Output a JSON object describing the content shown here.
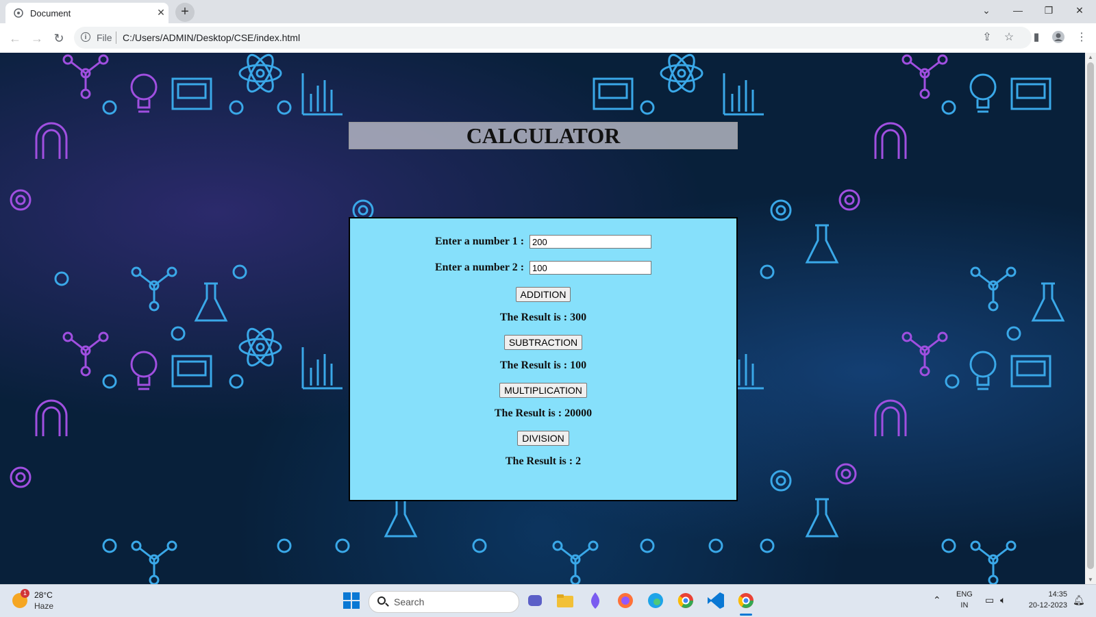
{
  "browser": {
    "tab_title": "Document",
    "tab_close": "✕",
    "new_tab": "+",
    "file_label": "File",
    "url": "C:/Users/ADMIN/Desktop/CSE/index.html"
  },
  "page": {
    "header": "CALCULATOR",
    "fields": [
      {
        "label": "Enter a number 1 :",
        "value": "200"
      },
      {
        "label": "Enter a number 2 :",
        "value": "100"
      }
    ],
    "operations": [
      {
        "button": "ADDITION",
        "result": "The Result is : 300"
      },
      {
        "button": "SUBTRACTION",
        "result": "The Result is : 100"
      },
      {
        "button": "MULTIPLICATION",
        "result": "The Result is : 20000"
      },
      {
        "button": "DIVISION",
        "result": "The Result is : 2"
      }
    ]
  },
  "taskbar": {
    "weather_temp": "28°C",
    "weather_cond": "Haze",
    "weather_badge": "1",
    "search_placeholder": "Search",
    "lang_1": "ENG",
    "lang_2": "IN",
    "time": "14:35",
    "date": "20-12-2023"
  },
  "colors": {
    "calc_bg": "#86e0fb",
    "page_bg": "#08203a",
    "icon_blue": "#3aa8e8",
    "icon_purple": "#a04fe0"
  }
}
